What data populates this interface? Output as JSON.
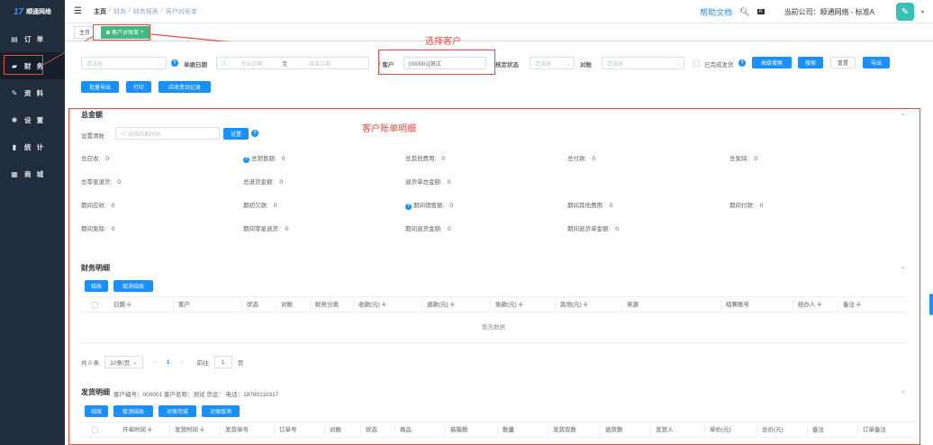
{
  "sidebar": {
    "logo": "顺通网络",
    "items": [
      {
        "label": "订 单",
        "icon": "▤"
      },
      {
        "label": "财 务",
        "icon": "▰"
      },
      {
        "label": "资 料",
        "icon": "✎"
      },
      {
        "label": "设 置",
        "icon": "✱"
      },
      {
        "label": "统 计",
        "icon": "▮"
      },
      {
        "label": "商 城",
        "icon": "▦"
      }
    ]
  },
  "header": {
    "breadcrumb": [
      "主页",
      "/",
      "财务",
      "/",
      "财务报表",
      "/",
      "客户对账单"
    ],
    "help": "帮助文档",
    "company": "当前公司：顺通网络 - 标准A"
  },
  "tags": {
    "home": "主页",
    "active": "客户对账单",
    "close": "×"
  },
  "filters": {
    "select1_placeholder": "请选择",
    "date_label": "单据日期",
    "start_placeholder": "开始日期",
    "to": "至",
    "end_placeholder": "结束日期",
    "customer_label": "客户",
    "customer_value": "[000001]测试",
    "settle_label": "核定状态",
    "settle_placeholder": "请选择",
    "recon_label": "对账",
    "recon_placeholder": "请选择",
    "done_label": "已完成发货",
    "btn_advanced": "高级搜索",
    "btn_search": "搜索",
    "btn_reset": "重置",
    "btn_export": "导出",
    "btn_batch_export": "批量导出",
    "btn_print": "打印",
    "btn_change_log": "应收变动记录"
  },
  "annotations": {
    "select_customer": "选择客户",
    "detail": "客户账单明细"
  },
  "totals": {
    "title": "总金额",
    "clear_label": "设置清账",
    "clear_placeholder": "选择日期时间",
    "clear_btn": "设置",
    "stats": [
      [
        "总应收:",
        "0"
      ],
      [
        "总销售额:",
        "0"
      ],
      [
        "总其他费用:",
        "0"
      ],
      [
        "总付款:",
        "0"
      ],
      [
        "总免除:",
        "0"
      ],
      [
        "总零星退货:",
        "0"
      ],
      [
        "总退货金额:",
        "0"
      ],
      [
        "退货单总金额:",
        "0"
      ],
      [
        "期间应收:",
        "0"
      ],
      [
        "期初欠款:",
        "0"
      ],
      [
        "期间销售额:",
        "0"
      ],
      [
        "期间其他费用:",
        "0"
      ],
      [
        "期间付款:",
        "0"
      ],
      [
        "期间免除:",
        "0"
      ],
      [
        "期间零星退货:",
        "0"
      ],
      [
        "期间退货金额:",
        "0"
      ],
      [
        "期间退货单金额:",
        "0"
      ]
    ]
  },
  "finance": {
    "title": "财务明细",
    "btn_settle": "结账",
    "btn_unsettle": "取消结账",
    "columns": [
      "日期 ≑",
      "客户",
      "状态",
      "对账",
      "财务分类",
      "收款(元) ≑",
      "退款(元) ≑",
      "免款(元) ≑",
      "其他(元) ≑",
      "来源",
      "结算账号",
      "经办人 ≑",
      "备注 ≑"
    ],
    "empty": "暂无数据",
    "pager": {
      "total": "共 0 条",
      "size": "10条/页",
      "prev": "‹",
      "page": "1",
      "next": "›",
      "goto": "前往",
      "goto_val": "1",
      "unit": "页"
    }
  },
  "shipping": {
    "title": "发货明细",
    "info": "客户编号：000001   客户名称：测试   货运：   电话：18780110317",
    "btn_settle": "结账",
    "btn_unsettle": "取消结账",
    "btn_recon_done": "对账完成",
    "btn_recon_cancel": "对账取消",
    "columns": [
      "开单时间 ≑",
      "发货时间 ≑",
      "发货单号",
      "订单号",
      "对账",
      "状态",
      "商品",
      "装箱数",
      "数量",
      "发货双数",
      "退货数",
      "发货人",
      "单价(元)",
      "总价(元)",
      "备注",
      "订单备注"
    ]
  }
}
